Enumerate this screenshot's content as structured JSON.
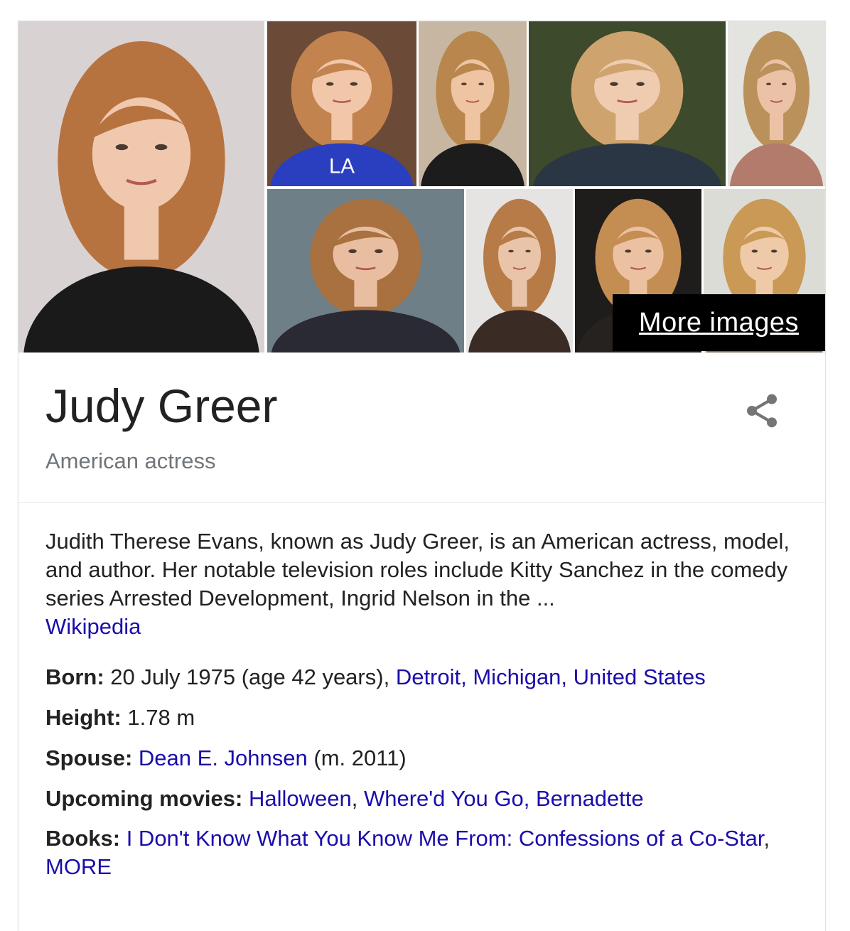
{
  "images": {
    "more_label": "More images",
    "photos": [
      {
        "name": "main-portrait-photo",
        "bg": "#d9d2d3",
        "hair": "#b7733f",
        "skin": "#f0c8ae",
        "top": "#1a1a1a"
      },
      {
        "name": "photo-blue-shirt",
        "bg": "#6b4a38",
        "hair": "#c3834e",
        "skin": "#f2c6a8",
        "top": "#2a3fbf",
        "shirt_text": "LA"
      },
      {
        "name": "photo-closeup-1",
        "bg": "#c7b7a2",
        "hair": "#b9874d",
        "skin": "#eec4a3",
        "top": "#1c1c1c"
      },
      {
        "name": "photo-leather-jacket",
        "bg": "#3d4a2b",
        "hair": "#cfa36e",
        "skin": "#efcbb0",
        "top": "#2b3645"
      },
      {
        "name": "photo-event-backdrop",
        "bg": "#e3e3e0",
        "hair": "#bb915b",
        "skin": "#ecc2a6",
        "top": "#b27b6b"
      },
      {
        "name": "photo-chair-pose",
        "bg": "#6f7f88",
        "hair": "#a8713f",
        "skin": "#e9bea0",
        "top": "#2a2a35"
      },
      {
        "name": "photo-lace-dress",
        "bg": "#e6e4e2",
        "hair": "#b77b48",
        "skin": "#eac4a8",
        "top": "#3a2c24"
      },
      {
        "name": "photo-dark-background",
        "bg": "#1f1d1b",
        "hair": "#c48d52",
        "skin": "#ebc1a2",
        "top": "#25221f"
      },
      {
        "name": "photo-comic-con-panel",
        "bg": "#dcdcd6",
        "hair": "#c99955",
        "skin": "#efcaa9",
        "top": "#7a6e60"
      }
    ]
  },
  "header": {
    "title": "Judy Greer",
    "subtitle": "American actress",
    "share_icon": "share-icon"
  },
  "description": {
    "text": "Judith Therese Evans, known as Judy Greer, is an American actress, model, and author. Her notable television roles include Kitty Sanchez in the comedy series Arrested Development, Ingrid Nelson in the ...",
    "source_link": "Wikipedia"
  },
  "facts": {
    "born": {
      "label": "Born:",
      "value": "20 July 1975 (age 42 years),",
      "links": [
        "Detroit",
        "Michigan",
        "United States"
      ]
    },
    "height": {
      "label": "Height:",
      "value": "1.78 m"
    },
    "spouse": {
      "label": "Spouse:",
      "link": "Dean E. Johnsen",
      "suffix": "(m. 2011)"
    },
    "upcoming": {
      "label": "Upcoming movies:",
      "links": [
        "Halloween",
        "Where'd You Go, Bernadette"
      ]
    },
    "books": {
      "label": "Books:",
      "links": [
        "I Don't Know What You Know Me From: Confessions of a Co-Star",
        "MORE"
      ]
    }
  },
  "colors": {
    "link": "#1a0dab",
    "text": "#222222",
    "muted": "#70757a"
  }
}
